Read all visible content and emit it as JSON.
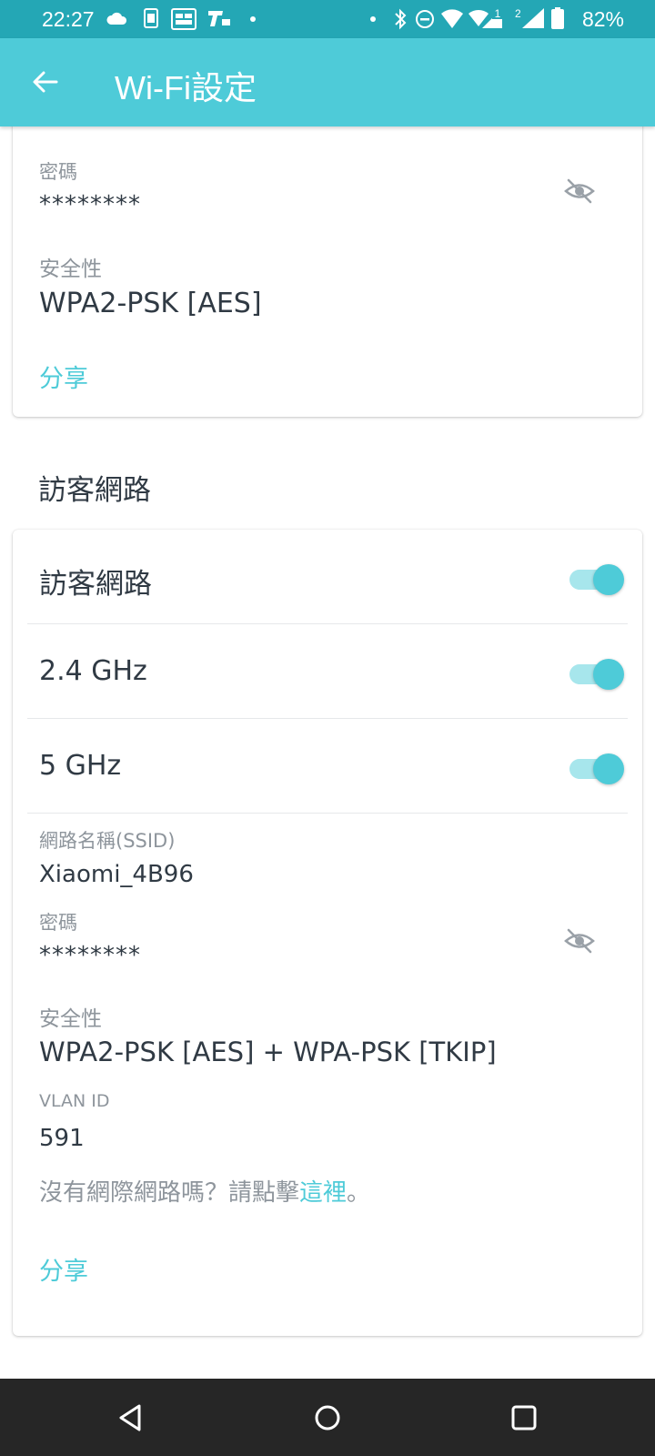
{
  "status_bar": {
    "time": "22:27",
    "battery_percent": "82%",
    "left_icons": [
      "cloud-icon",
      "sim-card-icon",
      "mc-app-icon",
      "t-app-icon",
      "dot-icon"
    ],
    "right_icons": [
      "dot-icon",
      "bluetooth-icon",
      "do-not-disturb-icon",
      "wifi-icon",
      "signal-sim1-icon",
      "signal-sim2-icon",
      "battery-icon"
    ],
    "sim1_label": "1",
    "sim2_label": "2"
  },
  "app_bar": {
    "title": "Wi-Fi設定",
    "back_icon": "arrow-left-icon"
  },
  "main_network_card": {
    "password_label": "密碼",
    "password_value": "********",
    "security_label": "安全性",
    "security_value": "WPA2-PSK [AES]",
    "share_label": "分享"
  },
  "guest_section": {
    "title": "訪客網路"
  },
  "guest_card": {
    "guest_toggle_label": "訪客網路",
    "guest_toggle_on": true,
    "band_24_label": "2.4 GHz",
    "band_24_on": true,
    "band_5_label": "5 GHz",
    "band_5_on": true,
    "ssid_label": "網路名稱(SSID)",
    "ssid_value": "Xiaomi_4B96",
    "password_label": "密碼",
    "password_value": "********",
    "security_label": "安全性",
    "security_value": "WPA2-PSK [AES] + WPA-PSK [TKIP]",
    "vlan_label": "VLAN ID",
    "vlan_value": "591",
    "no_internet_prefix": "沒有網際網路嗎？請點擊",
    "no_internet_link": "這裡",
    "no_internet_suffix": "。",
    "share_label": "分享"
  },
  "nav_bar": {
    "back": "triangle-back-icon",
    "home": "circle-home-icon",
    "recents": "square-recents-icon"
  },
  "colors": {
    "status_bar": "#24a7b5",
    "app_bar": "#4ecbd8",
    "accent": "#4ecbd8",
    "toggle_track": "#a7e6ec",
    "nav_bar": "#262626"
  }
}
